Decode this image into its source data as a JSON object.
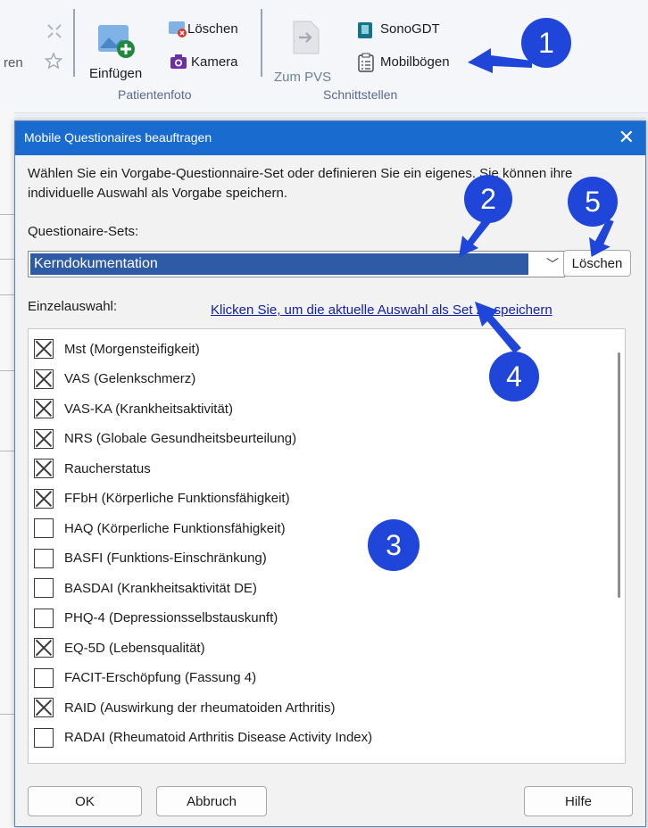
{
  "ribbon": {
    "partial_label": "ren",
    "insert_label": "Einfügen",
    "delete_label": "Löschen",
    "camera_label": "Kamera",
    "group_patientenfoto": "Patientenfoto",
    "to_pvs_label": "Zum PVS",
    "sonogdt_label": "SonoGDT",
    "mobilboegen_label": "Mobilbögen",
    "group_schnittstellen": "Schnittstellen"
  },
  "annotations": [
    "1",
    "2",
    "3",
    "4",
    "5"
  ],
  "dialog": {
    "title": "Mobile Questionaires beauftragen",
    "description": "Wählen Sie ein Vorgabe-Questionnaire-Set oder definieren Sie ein eigenes. Sie können ihre individuelle Auswahl als Vorgabe speichern.",
    "sets_label": "Questionaire-Sets:",
    "selected_set": "Kerndokumentation",
    "delete_button": "Löschen",
    "single_selection_label": "Einzelauswahl:",
    "save_set_link": "Klicken Sie, um die aktuelle Auswahl als Set zu speichern",
    "items": [
      {
        "label": "Mst (Morgensteifigkeit)",
        "checked": true
      },
      {
        "label": "VAS (Gelenkschmerz)",
        "checked": true
      },
      {
        "label": "VAS-KA (Krankheitsaktivität)",
        "checked": true
      },
      {
        "label": "NRS (Globale Gesundheitsbeurteilung)",
        "checked": true
      },
      {
        "label": "Raucherstatus",
        "checked": true
      },
      {
        "label": "FFbH (Körperliche Funktionsfähigkeit)",
        "checked": true
      },
      {
        "label": "HAQ (Körperliche Funktionsfähigkeit)",
        "checked": false
      },
      {
        "label": "BASFI (Funktions-Einschränkung)",
        "checked": false
      },
      {
        "label": "BASDAI (Krankheitsaktivität DE)",
        "checked": false
      },
      {
        "label": "PHQ-4 (Depressionsselbstauskunft)",
        "checked": false
      },
      {
        "label": "EQ-5D (Lebensqualität)",
        "checked": true
      },
      {
        "label": "FACIT-Erschöpfung (Fassung 4)",
        "checked": false
      },
      {
        "label": "RAID (Auswirkung der rheumatoiden Arthritis)",
        "checked": true
      },
      {
        "label": "RADAI (Rheumatoid Arthritis Disease Activity Index)",
        "checked": false
      }
    ],
    "ok_button": "OK",
    "cancel_button": "Abbruch",
    "help_button": "Hilfe"
  },
  "colors": {
    "titlebar": "#1a6bd0",
    "annotation": "#1f46d8",
    "selection": "#2e5aa6",
    "link": "#1320a6"
  }
}
